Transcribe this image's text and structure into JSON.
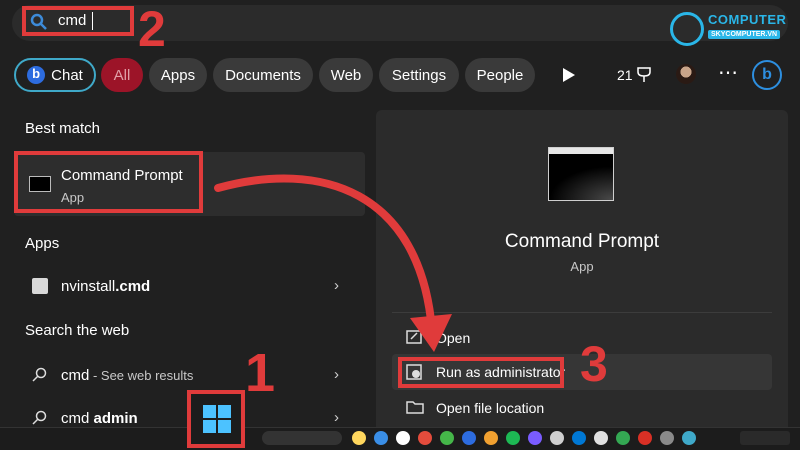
{
  "search": {
    "query": "cmd"
  },
  "filters": {
    "chat": "Chat",
    "all": "All",
    "apps": "Apps",
    "documents": "Documents",
    "web": "Web",
    "settings": "Settings",
    "people": "People",
    "points": "21"
  },
  "left": {
    "best_match_title": "Best match",
    "best_match": {
      "name": "Command Prompt",
      "type": "App"
    },
    "apps_title": "Apps",
    "apps": [
      {
        "prefix": "nvinstall",
        "suffix": ".cmd"
      }
    ],
    "web_title": "Search the web",
    "web": [
      {
        "term": "cmd",
        "sub": " - See web results"
      },
      {
        "prefix": "cmd ",
        "term": "admin"
      }
    ]
  },
  "detail": {
    "name": "Command Prompt",
    "type": "App",
    "actions": [
      "Open",
      "Run as administrator",
      "Open file location"
    ]
  },
  "annotations": {
    "one": "1",
    "two": "2",
    "three": "3"
  },
  "logo": {
    "name": "COMPUTER",
    "sub": "SKYCOMPUTER.VN"
  },
  "colors": {
    "accent_red": "#e03b3b",
    "chip_active": "#9c1428",
    "chat_border": "#3fa9c9",
    "logo": "#2ab6e8"
  },
  "icons": [
    "search-icon",
    "bing-icon",
    "play-icon",
    "more-icon",
    "chevron-right-icon",
    "cmd-app-icon",
    "shield-icon",
    "folder-icon",
    "windows-start-icon"
  ]
}
